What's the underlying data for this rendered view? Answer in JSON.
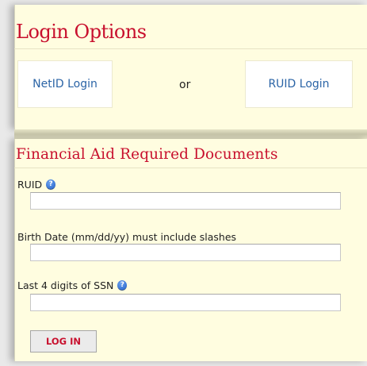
{
  "login_options": {
    "title": "Login Options",
    "netid_label": "NetID Login",
    "or_text": "or",
    "ruid_label": "RUID Login"
  },
  "fin_aid": {
    "title": "Financial Aid Required Documents",
    "fields": [
      {
        "label": "RUID",
        "value": "",
        "has_help": true
      },
      {
        "label": "Birth Date (mm/dd/yy) must include slashes",
        "value": "",
        "has_help": false
      },
      {
        "label": "Last 4 digits of SSN",
        "value": "",
        "has_help": true
      }
    ],
    "submit_label": "LOG IN",
    "help_glyph": "?"
  },
  "colors": {
    "accent_red": "#c8102e",
    "link_blue": "#2b64a6",
    "panel_bg": "#fffde0"
  },
  "icons": {
    "help": "help-icon"
  }
}
